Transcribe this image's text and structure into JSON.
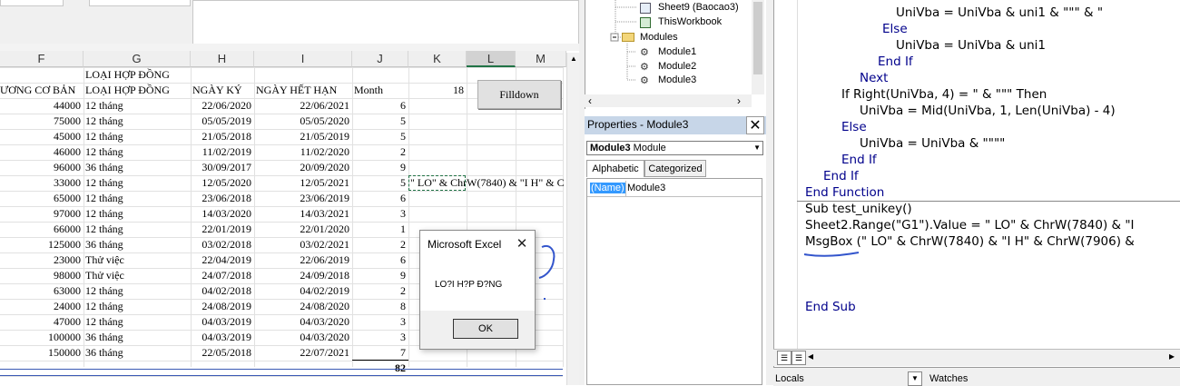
{
  "excel": {
    "columns": [
      "F",
      "G",
      "H",
      "I",
      "J",
      "K",
      "L",
      "M"
    ],
    "header_rows": {
      "group": "LOẠI HỢP ĐỒNG",
      "labels": [
        "ƯƠNG CƠ BẢN",
        "LOẠI HỢP ĐỒNG",
        "NGÀY KÝ",
        "NGÀY HẾT HẠN",
        "Month"
      ],
      "k_value": "18"
    },
    "rows": [
      {
        "salary": "44000",
        "type": "12 tháng",
        "signed": "22/06/2020",
        "expires": "22/06/2021",
        "month": "6"
      },
      {
        "salary": "75000",
        "type": "12 tháng",
        "signed": "05/05/2019",
        "expires": "05/05/2020",
        "month": "5"
      },
      {
        "salary": "45000",
        "type": "12 tháng",
        "signed": "21/05/2018",
        "expires": "21/05/2019",
        "month": "5"
      },
      {
        "salary": "46000",
        "type": "12 tháng",
        "signed": "11/02/2019",
        "expires": "11/02/2020",
        "month": "2"
      },
      {
        "salary": "96000",
        "type": "36 tháng",
        "signed": "30/09/2017",
        "expires": "20/09/2020",
        "month": "9"
      },
      {
        "salary": "33000",
        "type": "12 tháng",
        "signed": "12/05/2020",
        "expires": "12/05/2021",
        "month": "5"
      },
      {
        "salary": "65000",
        "type": "12 tháng",
        "signed": "23/06/2018",
        "expires": "23/06/2019",
        "month": "6"
      },
      {
        "salary": "97000",
        "type": "12 tháng",
        "signed": "14/03/2020",
        "expires": "14/03/2021",
        "month": "3"
      },
      {
        "salary": "66000",
        "type": "12 tháng",
        "signed": "22/01/2019",
        "expires": "22/01/2020",
        "month": "1"
      },
      {
        "salary": "125000",
        "type": "36 tháng",
        "signed": "03/02/2018",
        "expires": "03/02/2021",
        "month": "2"
      },
      {
        "salary": "23000",
        "type": "Thử việc",
        "signed": "22/04/2019",
        "expires": "22/06/2019",
        "month": "6"
      },
      {
        "salary": "98000",
        "type": "Thử việc",
        "signed": "24/07/2018",
        "expires": "24/09/2018",
        "month": "9"
      },
      {
        "salary": "63000",
        "type": "12 tháng",
        "signed": "04/02/2018",
        "expires": "04/02/2019",
        "month": "2"
      },
      {
        "salary": "24000",
        "type": "12 tháng",
        "signed": "24/08/2019",
        "expires": "24/08/2020",
        "month": "8"
      },
      {
        "salary": "47000",
        "type": "12 tháng",
        "signed": "04/03/2019",
        "expires": "04/03/2020",
        "month": "3"
      },
      {
        "salary": "100000",
        "type": "36 tháng",
        "signed": "04/03/2019",
        "expires": "04/03/2020",
        "month": "3"
      },
      {
        "salary": "150000",
        "type": "36 tháng",
        "signed": "22/05/2018",
        "expires": "22/07/2021",
        "month": "7"
      }
    ],
    "total": "82",
    "k_cell_text": "\" LO\" & ChrW(7840) & \"I H\" & C",
    "filldown_label": "Filldown"
  },
  "msgbox": {
    "title": "Microsoft Excel",
    "close": "✕",
    "message": "LO?I H?P Đ?NG",
    "ok": "OK"
  },
  "project": {
    "items": [
      {
        "label": "Sheet9 (Baocao3)",
        "icon": "sheet-icon"
      },
      {
        "label": "ThisWorkbook",
        "icon": "workbook-icon"
      },
      {
        "label": "Modules",
        "icon": "folder-icon"
      },
      {
        "label": "Module1",
        "icon": "module-icon"
      },
      {
        "label": "Module2",
        "icon": "module-icon"
      },
      {
        "label": "Module3",
        "icon": "module-icon"
      }
    ]
  },
  "properties": {
    "title": "Properties - Module3",
    "close": "✕",
    "combo_bold": "Module3",
    "combo_rest": " Module",
    "tabs": [
      "Alphabetic",
      "Categorized"
    ],
    "row_name": "(Name)",
    "row_value": "Module3"
  },
  "code": {
    "lines": [
      "UniVba = UniVba & uni1 & \"\"\" & \"",
      "Else",
      "UniVba = UniVba & uni1",
      "End If",
      "Next",
      "If Right(UniVba, 4) = \" & \"\"\" Then",
      "UniVba = Mid(UniVba, 1, Len(UniVba) - 4)",
      "Else",
      "UniVba = UniVba & \"\"\"\"",
      "End If",
      "End If",
      "End Function",
      "Sub test_unikey()",
      "Sheet2.Range(\"G1\").Value = \" LO\" & ChrW(7840) & \"I",
      "MsgBox (\" LO\" & ChrW(7840) & \"I H\" & ChrW(7906) &",
      "End Sub"
    ],
    "bottom_labels": [
      "Locals",
      "Watches"
    ]
  }
}
